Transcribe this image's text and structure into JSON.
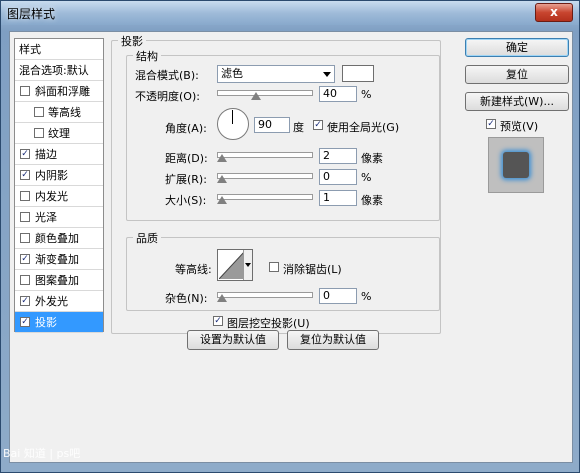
{
  "window": {
    "title": "图层样式",
    "close_label": "x"
  },
  "style_list": {
    "header": "样式",
    "blend_options": "混合选项:默认",
    "items": [
      {
        "label": "斜面和浮雕",
        "checked": false,
        "indent": false,
        "selected": false
      },
      {
        "label": "等高线",
        "checked": false,
        "indent": true,
        "selected": false
      },
      {
        "label": "纹理",
        "checked": false,
        "indent": true,
        "selected": false
      },
      {
        "label": "描边",
        "checked": true,
        "indent": false,
        "selected": false
      },
      {
        "label": "内阴影",
        "checked": true,
        "indent": false,
        "selected": false
      },
      {
        "label": "内发光",
        "checked": false,
        "indent": false,
        "selected": false
      },
      {
        "label": "光泽",
        "checked": false,
        "indent": false,
        "selected": false
      },
      {
        "label": "颜色叠加",
        "checked": false,
        "indent": false,
        "selected": false
      },
      {
        "label": "渐变叠加",
        "checked": true,
        "indent": false,
        "selected": false
      },
      {
        "label": "图案叠加",
        "checked": false,
        "indent": false,
        "selected": false
      },
      {
        "label": "外发光",
        "checked": true,
        "indent": false,
        "selected": false
      },
      {
        "label": "投影",
        "checked": true,
        "indent": false,
        "selected": true
      }
    ]
  },
  "drop_shadow": {
    "section_title": "投影",
    "structure": {
      "title": "结构",
      "blend_mode_label": "混合模式(B):",
      "blend_mode_value": "滤色",
      "blend_color": "#ffffff",
      "opacity_label": "不透明度(O):",
      "opacity_value": "40",
      "opacity_unit": "%",
      "opacity_level": 0.4,
      "angle_label": "角度(A):",
      "angle_value": "90",
      "angle_unit": "度",
      "global_light_label": "使用全局光(G)",
      "global_light_checked": true,
      "distance_label": "距离(D):",
      "distance_value": "2",
      "distance_unit": "像素",
      "distance_level": 0.0,
      "spread_label": "扩展(R):",
      "spread_value": "0",
      "spread_unit": "%",
      "spread_level": 0.0,
      "size_label": "大小(S):",
      "size_value": "1",
      "size_unit": "像素",
      "size_level": 0.0
    },
    "quality": {
      "title": "品质",
      "contour_label": "等高线:",
      "anti_alias_label": "消除锯齿(L)",
      "anti_alias_checked": false,
      "noise_label": "杂色(N):",
      "noise_value": "0",
      "noise_unit": "%",
      "noise_level": 0.0
    },
    "knockout_label": "图层挖空投影(U)",
    "knockout_checked": true,
    "make_default_label": "设置为默认值",
    "reset_default_label": "复位为默认值"
  },
  "buttons": {
    "ok": "确定",
    "reset": "复位",
    "new_style": "新建样式(W)...",
    "preview_label": "预览(V)",
    "preview_checked": true
  },
  "watermark": "Bai 知道 | ps吧"
}
